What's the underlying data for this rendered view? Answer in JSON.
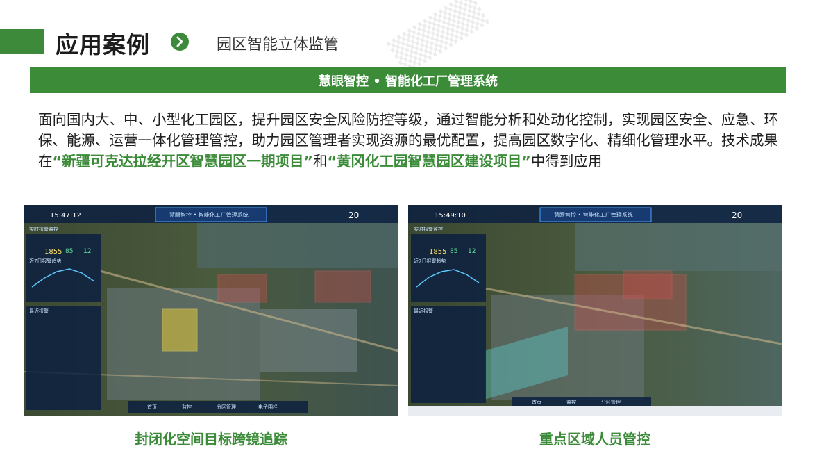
{
  "header": {
    "title": "应用案例",
    "subtitle": "园区智能立体监管",
    "accent": "#3b8b39"
  },
  "banner": {
    "text": "慧眼智控 • 智能化工厂管理系统"
  },
  "intro": {
    "part1": "面向国内大、中、小型化工园区，提升园区安全风险防控等级，通过智能分析和处动化控制，实现园区安全、应急、环保、能源、运营一体化管理管控，助力园区管理者实现资源的最优配置，提高园区数字化、精细化管理水平。技术成果在",
    "highlight1": "“新疆可克达拉经开区智慧园区一期项目”",
    "part2": "和",
    "highlight2": "“黄冈化工园智慧园区建设项目”",
    "part3": "中得到应用"
  },
  "screens": [
    {
      "caption": "封闭化空间目标跨镜追踪",
      "title": "慧眼智控 • 智能化工厂管理系统",
      "time": "15:47:12",
      "temp": "20",
      "stat1_label": "实时报警监控",
      "stat_value": "1855",
      "stat2": "85",
      "stat3": "12",
      "trend_label": "近7日报警趋势",
      "list_label": "最近报警",
      "nav": [
        "首页",
        "监控",
        "分区管理",
        "电子围栏"
      ]
    },
    {
      "caption": "重点区域人员管控",
      "title": "慧眼智控 • 智能化工厂管理系统",
      "time": "15:49:10",
      "temp": "20",
      "stat1_label": "实时报警监控",
      "stat_value": "1855",
      "stat2": "85",
      "stat3": "12",
      "trend_label": "近7日报警趋势",
      "list_label": "最近报警",
      "nav": [
        "首页",
        "监控",
        "分区管理"
      ]
    }
  ]
}
